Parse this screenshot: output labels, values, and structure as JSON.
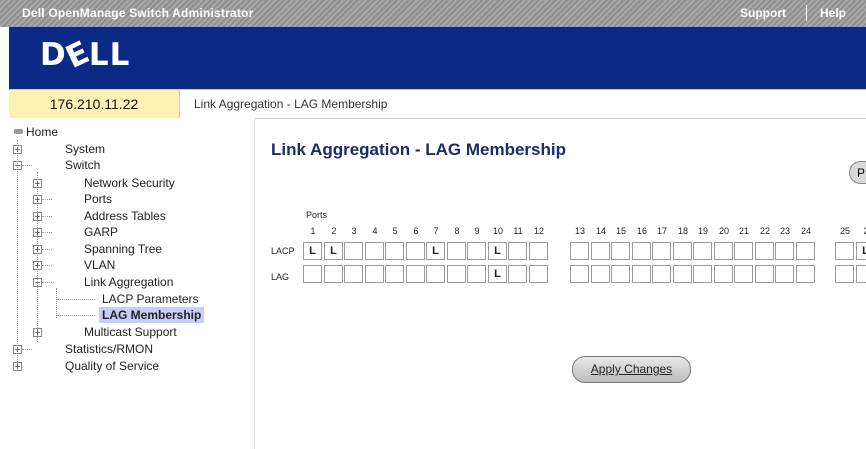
{
  "titlebar": {
    "title": "Dell OpenManage Switch Administrator",
    "support": "Support",
    "help": "Help"
  },
  "banner": {
    "logo": "DELL"
  },
  "ip": "176.210.11.22",
  "breadcrumb": "Link Aggregation - LAG Membership",
  "nav": {
    "home": "Home",
    "system": "System",
    "switch": "Switch",
    "network_security": "Network Security",
    "ports": "Ports",
    "address_tables": "Address Tables",
    "garp": "GARP",
    "spanning_tree": "Spanning Tree",
    "vlan": "VLAN",
    "link_aggregation": "Link Aggregation",
    "lacp_parameters": "LACP Parameters",
    "lag_membership": "LAG Membership",
    "multicast_support": "Multicast Support",
    "statistics": "Statistics/RMON",
    "qos": "Quality of Service"
  },
  "main": {
    "title": "Link Aggregation - LAG Membership",
    "print": "P",
    "ports_label": "Ports",
    "lacp_label": "LACP",
    "lag_label": "LAG",
    "apply": "Apply Changes"
  },
  "ports": {
    "group1": [
      "1",
      "2",
      "3",
      "4",
      "5",
      "6",
      "7",
      "8",
      "9",
      "10",
      "11",
      "12"
    ],
    "group2": [
      "13",
      "14",
      "15",
      "16",
      "17",
      "18",
      "19",
      "20",
      "21",
      "22",
      "23",
      "24"
    ],
    "group3": [
      "25",
      "2"
    ]
  },
  "lacp_marks": {
    "1": "L",
    "2": "L",
    "7": "L",
    "10": "L"
  },
  "lag_marks": {
    "10": "L"
  }
}
